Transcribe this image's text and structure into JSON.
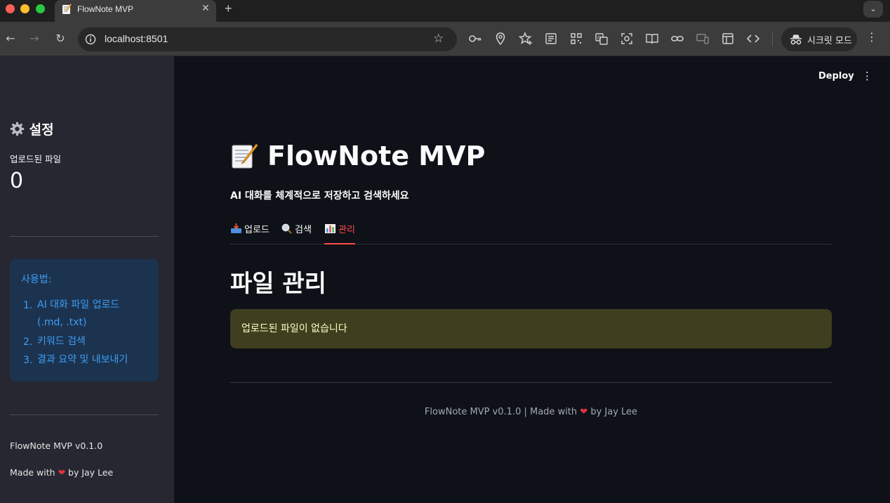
{
  "browser": {
    "tab_title": "FlowNote MVP",
    "tab_close": "✕",
    "new_tab": "+",
    "tab_menu": "⌄",
    "url": "localhost:8501",
    "incognito_label": "시크릿 모드"
  },
  "app": {
    "deploy_label": "Deploy",
    "title": "FlowNote MVP",
    "subtitle": "AI 대화를 체계적으로 저장하고 검색하세요",
    "tabs": [
      {
        "label": "업로드"
      },
      {
        "label": "검색"
      },
      {
        "label": "관리"
      }
    ],
    "active_tab": "관리",
    "section_title": "파일 관리",
    "warning_message": "업로드된 파일이 없습니다",
    "footer": {
      "prefix": "FlowNote MVP v0.1.0 | Made with",
      "suffix": "by Jay Lee"
    }
  },
  "sidebar": {
    "heading": "설정",
    "metric_label": "업로드된 파일",
    "metric_value": "0",
    "info_title": "사용법:",
    "steps": [
      {
        "num": "1.",
        "text": "AI 대화 파일 업로드 (.md, .txt)"
      },
      {
        "num": "2.",
        "text": "키워드 검색"
      },
      {
        "num": "3.",
        "text": "결과 요약 및 내보내기"
      }
    ],
    "version": "FlowNote MVP v0.1.0",
    "made_prefix": "Made with",
    "made_suffix": "by Jay Lee"
  },
  "colors": {
    "accent": "#ff4b4b",
    "sidebar_bg": "#262730",
    "main_bg": "#0e1117",
    "info_bg": "#1c3350",
    "info_text": "#3d9df3",
    "warning_bg": "#3f3f20",
    "warning_text": "#fffcc2"
  },
  "icons": {
    "heading": "gear-icon",
    "title": "memo-icon",
    "tab_upload": "inbox-tray-icon",
    "tab_search": "magnifier-icon",
    "tab_manage": "bar-chart-icon",
    "heart": "heart-icon"
  }
}
